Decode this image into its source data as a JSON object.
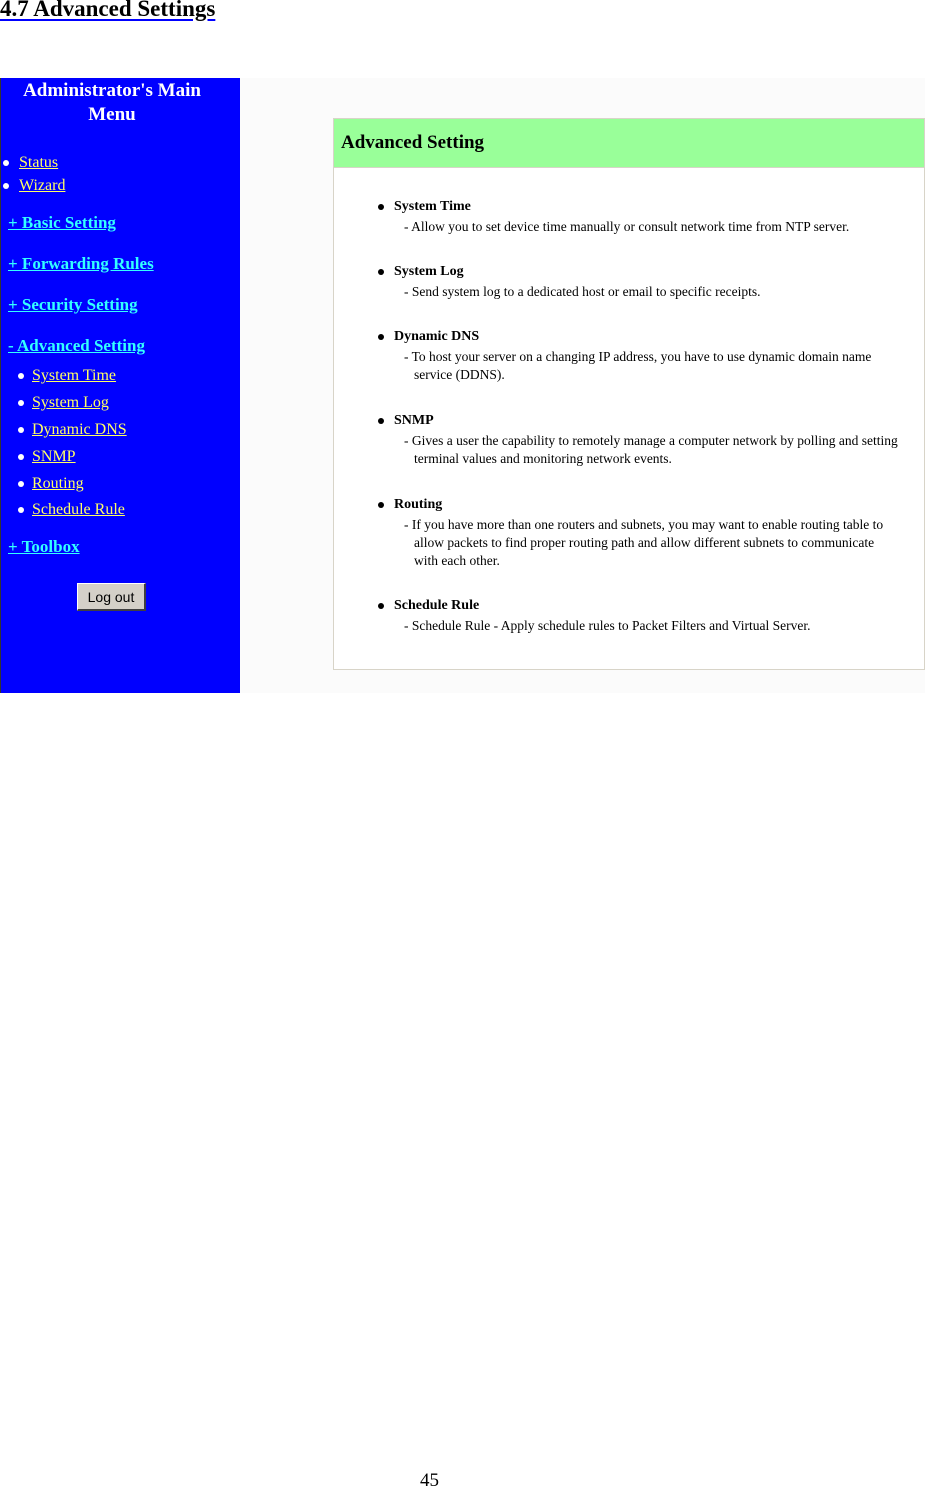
{
  "document": {
    "heading": "4.7 Advanced Settings",
    "page_number": "45"
  },
  "sidebar": {
    "title": "Administrator's Main Menu",
    "top_links": [
      {
        "label": "Status"
      },
      {
        "label": "Wizard"
      }
    ],
    "sections": [
      {
        "label": "+ Basic Setting"
      },
      {
        "label": "+ Forwarding Rules"
      },
      {
        "label": "+ Security Setting"
      },
      {
        "label": "- Advanced Setting"
      },
      {
        "label": "+ Toolbox"
      }
    ],
    "advanced_sub_items": [
      {
        "label": "System Time"
      },
      {
        "label": "System Log"
      },
      {
        "label": "Dynamic DNS"
      },
      {
        "label": "SNMP"
      },
      {
        "label": "Routing"
      },
      {
        "label": "Schedule Rule"
      }
    ],
    "logout_label": "Log out"
  },
  "panel": {
    "title": "Advanced Setting",
    "items": [
      {
        "title": "System Time",
        "desc": "- Allow you to set device time manually or consult network time from NTP server."
      },
      {
        "title": "System Log",
        "desc": "- Send system log to a dedicated host or email to specific receipts."
      },
      {
        "title": "Dynamic DNS",
        "desc": "- To host your server on a changing IP address, you have to use dynamic domain name service (DDNS)."
      },
      {
        "title": "SNMP",
        "desc": "- Gives a user the capability to remotely manage a computer network by polling and setting terminal values and monitoring network events."
      },
      {
        "title": "Routing",
        "desc": "- If you have more than one routers and subnets, you may want to enable routing table to allow packets to find proper routing path and allow different subnets to communicate with each other."
      },
      {
        "title": "Schedule Rule",
        "desc": "- Schedule Rule - Apply schedule rules to Packet Filters and Virtual Server."
      }
    ]
  },
  "colors": {
    "sidebar_bg": "#0000ff",
    "sidebar_link_yellow": "#ffff66",
    "sidebar_section_cyan": "#33ffff",
    "panel_header_bg": "#99ff99"
  }
}
